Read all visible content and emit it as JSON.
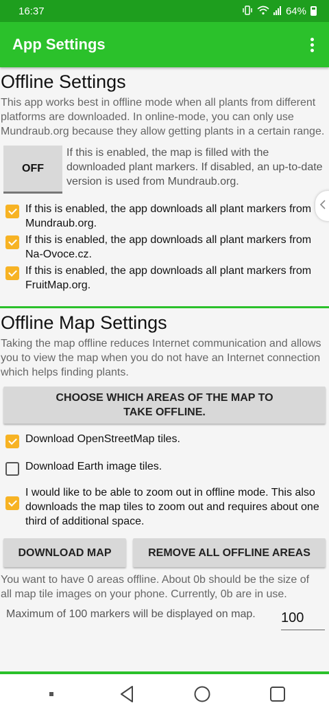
{
  "status_bar": {
    "time": "16:37",
    "battery": "64%",
    "icons": [
      "vibrate-icon",
      "wifi-icon",
      "signal-icon",
      "battery-icon"
    ]
  },
  "app_bar": {
    "title": "App Settings",
    "menu_icon": "more-vert-icon"
  },
  "offline_settings": {
    "title": "Offline Settings",
    "description": "This app works best in offline mode when all plants from different platforms are downloaded. In online-mode, you can only use Mundraub.org because they allow getting plants in a certain range.",
    "toggle_label": "OFF",
    "toggle_description": "If this is enabled, the map is filled with the downloaded plant markers. If disabled, an up-to-date version is used from Mundraub.org.",
    "checkboxes": [
      {
        "label": "If this is enabled, the app downloads all plant markers from Mundraub.org.",
        "checked": true
      },
      {
        "label": "If this is enabled, the app downloads all plant markers from Na-Ovoce.cz.",
        "checked": true
      },
      {
        "label": "If this is enabled, the app downloads all plant markers from FruitMap.org.",
        "checked": true
      }
    ]
  },
  "offline_map_settings": {
    "title": "Offline Map Settings",
    "description": "Taking the map offline reduces Internet communication and allows you to view the map when you do not have an Internet connection which helps finding plants.",
    "choose_areas_button": "CHOOSE WHICH AREAS OF THE MAP TO TAKE OFFLINE.",
    "checkboxes": [
      {
        "label": "Download OpenStreetMap tiles.",
        "checked": true
      },
      {
        "label": "Download Earth image tiles.",
        "checked": false
      },
      {
        "label": "I would like to be able to zoom out in offline mode. This also downloads the map tiles to zoom out and requires about one third of additional space.",
        "checked": true
      }
    ],
    "download_button": "DOWNLOAD MAP",
    "remove_button": "REMOVE ALL OFFLINE AREAS",
    "status_text": "You want to have 0 areas offline. About 0b should be the size of all map tile images on your phone. Currently, 0b are in use.",
    "markers_label": "Maximum of 100 markers will be displayed on map.",
    "markers_value": "100"
  },
  "colors": {
    "status_bar": "#1e9e1e",
    "app_bar": "#2bc12b",
    "checkbox_accent": "#f7b324",
    "button_bg": "#d8d8d8"
  },
  "nav_bar": {
    "icons": [
      "square-dot-icon",
      "back-icon",
      "home-icon",
      "recents-icon"
    ]
  }
}
